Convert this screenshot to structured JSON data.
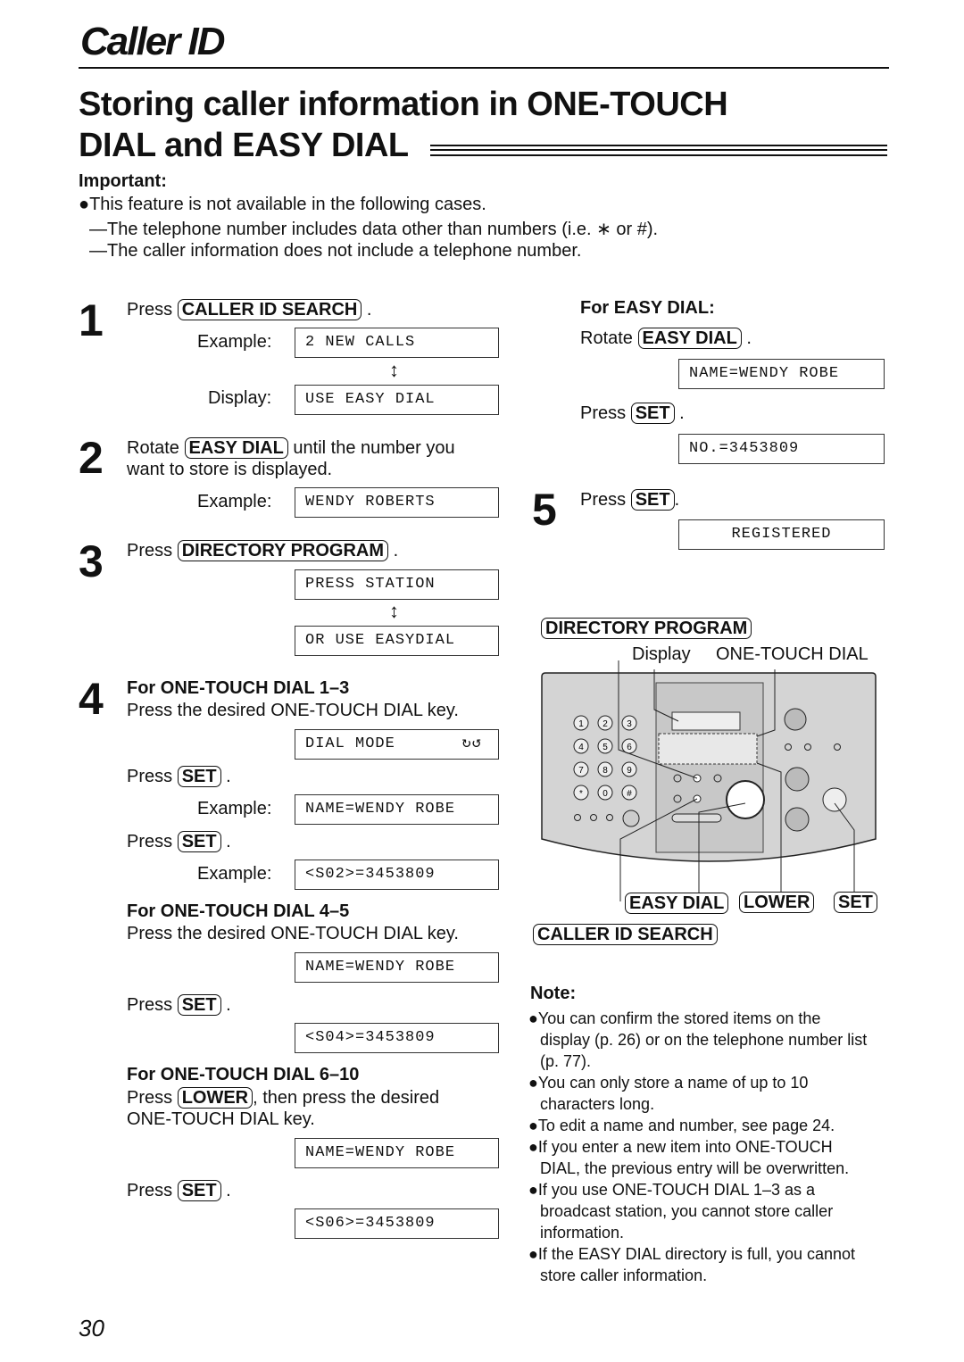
{
  "header": {
    "section": "Caller ID",
    "title_line1": "Storing caller information in ONE-TOUCH",
    "title_line2": "DIAL and EASY DIAL"
  },
  "important": {
    "label": "Important:",
    "lines": [
      "●This feature is not available in the following cases.",
      "—The telephone number includes data other than numbers (i.e. ∗ or #).",
      "—The caller information does not include a telephone number."
    ]
  },
  "steps": {
    "s1": {
      "num": "1",
      "press": "Press",
      "key": "CALLER ID SEARCH",
      "example": "Example:",
      "lcd1": "2 NEW CALLS",
      "display": "Display:",
      "lcd2": "USE EASY DIAL"
    },
    "s2": {
      "num": "2",
      "rotate": "Rotate",
      "key": "EASY DIAL",
      "text1": "until the number you",
      "text2": "want to store is displayed.",
      "example": "Example:",
      "lcd": "WENDY ROBERTS"
    },
    "s3": {
      "num": "3",
      "press": "Press",
      "key": "DIRECTORY PROGRAM",
      "lcd1": "PRESS STATION",
      "lcd2": "OR USE EASYDIAL"
    },
    "s4": {
      "num": "4",
      "a_title": "For ONE-TOUCH DIAL 1–3",
      "a_text": "Press the desired ONE-TOUCH DIAL key.",
      "a_lcd1": "DIAL MODE",
      "press": "Press",
      "set": "SET",
      "example": "Example:",
      "a_lcd2": "NAME=WENDY ROBE",
      "a_lcd3": "<S02>=3453809",
      "b_title": "For ONE-TOUCH DIAL 4–5",
      "b_text": "Press the desired ONE-TOUCH DIAL key.",
      "b_lcd1": "NAME=WENDY ROBE",
      "b_lcd2": "<S04>=3453809",
      "c_title": "For ONE-TOUCH DIAL 6–10",
      "c_text1": "Press",
      "c_key": "LOWER",
      "c_text2": ", then press the desired",
      "c_text3": "ONE-TOUCH DIAL key.",
      "c_lcd1": "NAME=WENDY ROBE",
      "c_lcd2": "<S06>=3453809"
    },
    "easy": {
      "title": "For EASY DIAL:",
      "rotate": "Rotate",
      "key": "EASY DIAL",
      "lcd1": "NAME=WENDY ROBE",
      "press": "Press",
      "set": "SET",
      "lcd2": "NO.=3453809"
    },
    "s5": {
      "num": "5",
      "press": "Press",
      "set": "SET",
      "lcd": "REGISTERED"
    }
  },
  "diagram": {
    "directory_program": "DIRECTORY PROGRAM",
    "display": "Display",
    "one_touch": "ONE-TOUCH DIAL",
    "easy_dial": "EASY DIAL",
    "lower": "LOWER",
    "set": "SET",
    "caller_id_search": "CALLER ID SEARCH",
    "keypad": [
      "1",
      "2",
      "3",
      "4",
      "5",
      "6",
      "7",
      "8",
      "9",
      "*",
      "0",
      "#"
    ],
    "panel_color": "#d4d4d4"
  },
  "note": {
    "label": "Note:",
    "items": [
      "●You can confirm the stored items on the",
      "display (p. 26) or on the telephone number list",
      "(p. 77).",
      "●You can only store a name of up to 10",
      "characters long.",
      "●To edit a name and number, see page 24.",
      "●If you enter a new item into ONE-TOUCH",
      "DIAL, the previous entry will be overwritten.",
      "●If you use ONE-TOUCH DIAL 1–3 as a",
      "broadcast station, you cannot store caller",
      "information.",
      "●If the EASY DIAL directory is full, you cannot",
      "store caller information."
    ]
  },
  "page_number": "30"
}
